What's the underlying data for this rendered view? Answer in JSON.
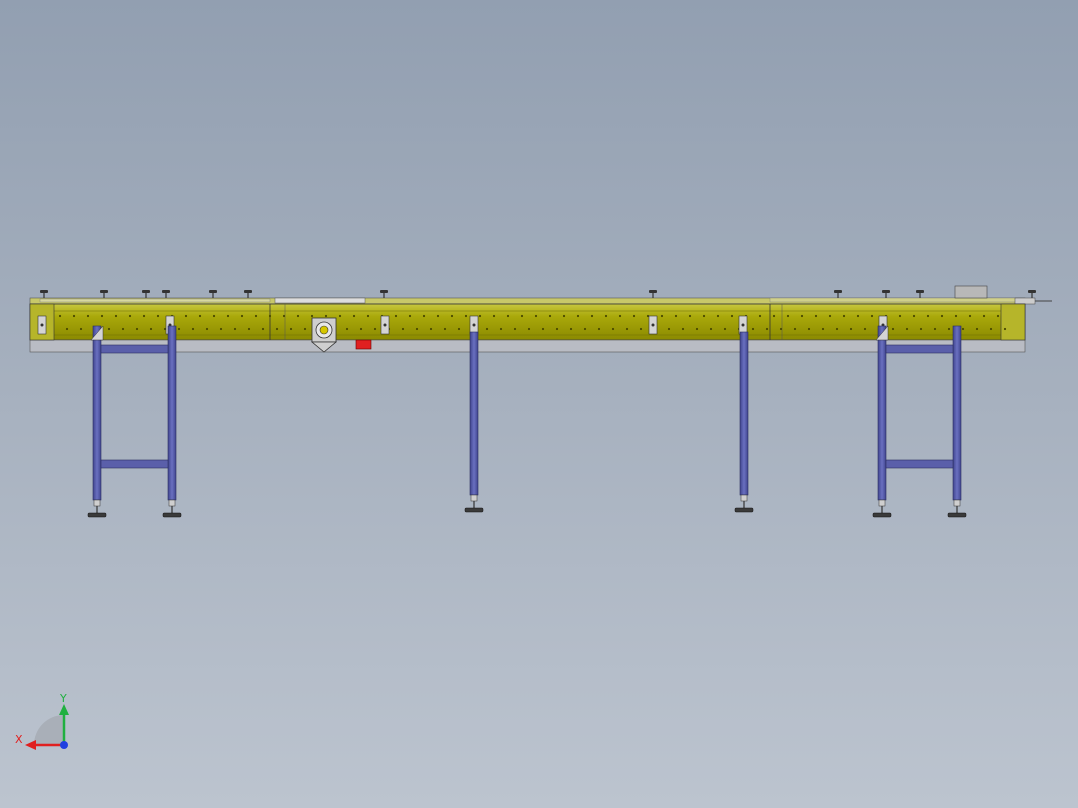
{
  "view": {
    "background_top": "#929fb1",
    "background_bottom": "#bcc4cf"
  },
  "model": {
    "frame_color": "#a0a000",
    "frame_highlight": "#c4c43a",
    "leg_color": "#5a5faa",
    "leg_dark": "#3c4080",
    "motor_color": "#d0d0d0",
    "stop_button_color": "#e02020"
  },
  "triad": {
    "x_label": "X",
    "y_label": "Y",
    "x_color": "#e02020",
    "y_color": "#20b040",
    "z_color": "#2040e0"
  }
}
